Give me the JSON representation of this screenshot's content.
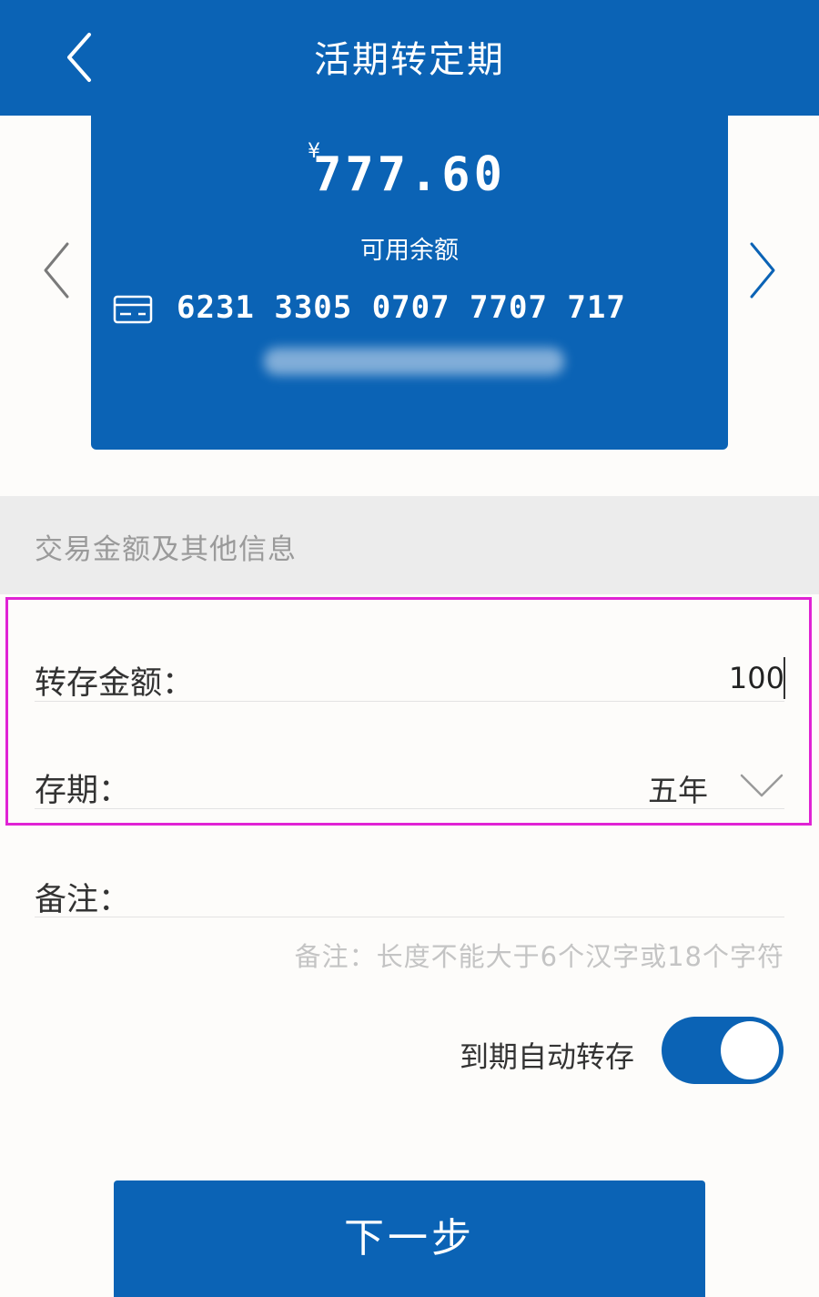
{
  "header": {
    "title": "活期转定期",
    "back_icon": "chevron-left-icon"
  },
  "account_card": {
    "currency_symbol": "¥",
    "balance": "777.60",
    "balance_label": "可用余额",
    "card_number": "6231 3305 0707 7707 717",
    "card_icon": "bank-card-icon"
  },
  "section": {
    "title": "交易金额及其他信息"
  },
  "form": {
    "amount_label": "转存金额：",
    "amount_value": "100",
    "term_label": "存期：",
    "term_value": "五年",
    "remark_label": "备注：",
    "remark_hint": "备注：长度不能大于6个汉字或18个字符"
  },
  "auto_renew": {
    "label": "到期自动转存",
    "enabled": true
  },
  "next_button": {
    "label": "下一步"
  },
  "colors": {
    "primary": "#0b63b5",
    "highlight": "#e023d4",
    "hint": "#c4c4c4"
  }
}
